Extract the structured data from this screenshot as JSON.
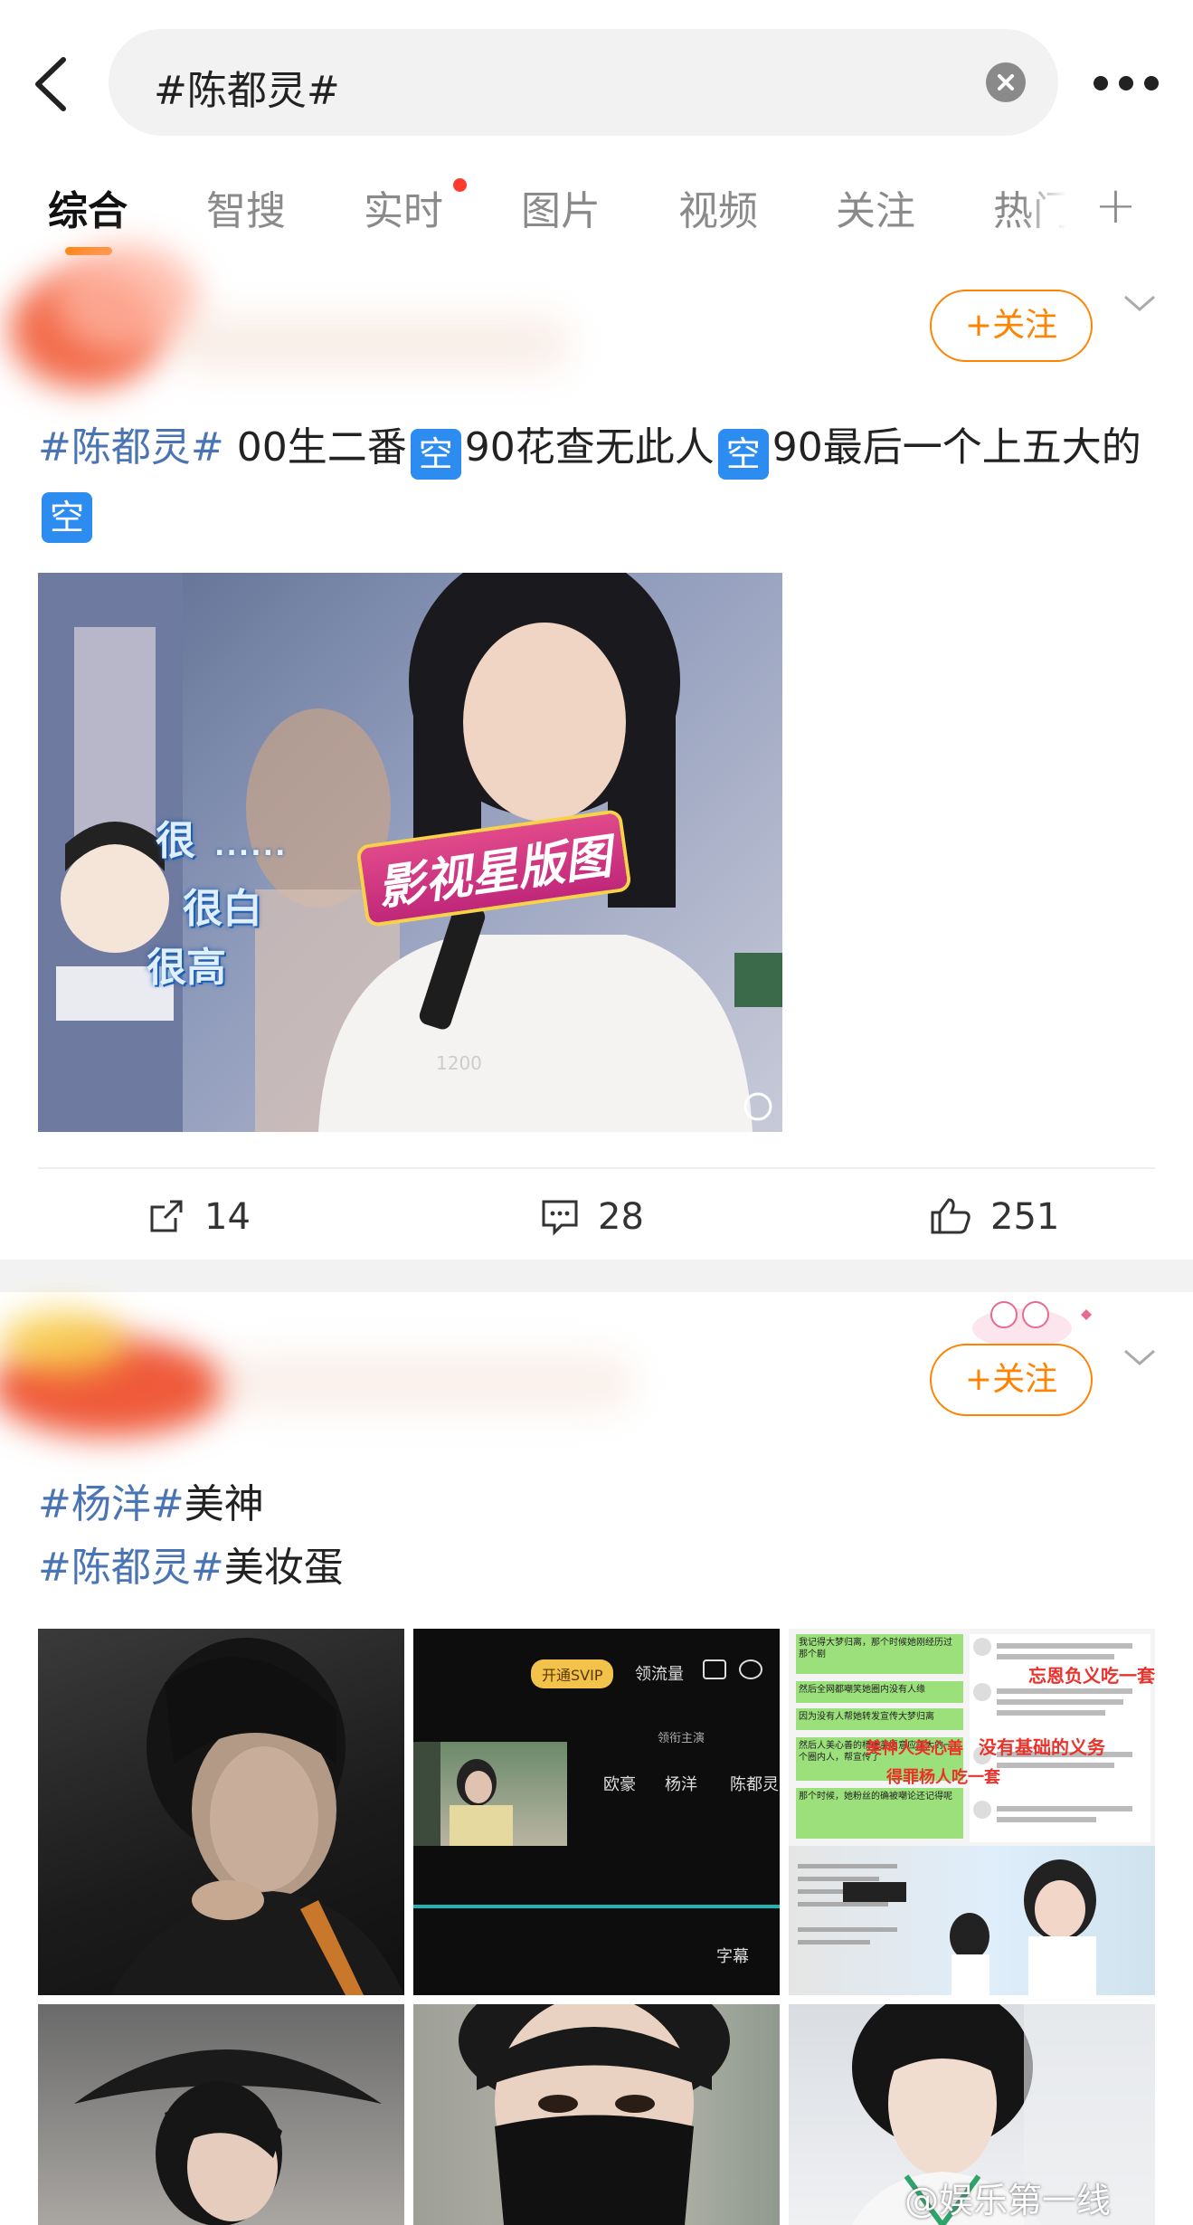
{
  "search": {
    "query": "#陈都灵#"
  },
  "tabs": [
    {
      "label": "综合",
      "active": true
    },
    {
      "label": "智搜"
    },
    {
      "label": "实时",
      "has_dot": true
    },
    {
      "label": "图片"
    },
    {
      "label": "视频"
    },
    {
      "label": "关注"
    },
    {
      "label": "热门"
    }
  ],
  "post1": {
    "follow_label": "+关注",
    "text_hashtag": "#陈都灵#",
    "text_parts": [
      "00生二番",
      "90花查无此人",
      "90最后一个上五大的"
    ],
    "badge": "空",
    "video_overlay": {
      "brand": "影视星版图",
      "caption_1": "很",
      "caption_2": "很白",
      "caption_3": "很高",
      "dots": "......",
      "watermark": "1200"
    },
    "reposts": "14",
    "comments": "28",
    "likes": "251"
  },
  "post2": {
    "follow_label": "+关注",
    "line1_hashtag": "#杨洋#",
    "line1_text": "美神",
    "line2_hashtag": "#陈都灵#",
    "line2_text": "美妆蛋",
    "grid_text": {
      "svip": "开通SVIP",
      "liuliang": "领流量",
      "names": [
        "欧豪",
        "杨洋",
        "陈都灵"
      ],
      "subtitle": "字幕",
      "role": "领衔主演",
      "chat_1": "我记得大梦归离，那个时候她刚经历过那个剧",
      "chat_2": "然后全网都嘲笑她圈内没有人缘",
      "chat_3": "因为没有人帮她转发宣传大梦归离",
      "chat_4": "然后人美心善的杨老美愿意应援大的一个圈内人，帮宣传了",
      "chat_5": "那个时候，她粉丝的确被嘲论还记得呢",
      "ann_1": "忘恩负义吃一套",
      "ann_2": "没有基础的义务",
      "ann_3": "美神人美心善",
      "ann_4": "得罪杨人吃一套"
    },
    "watermark": "@娱乐第一线"
  }
}
